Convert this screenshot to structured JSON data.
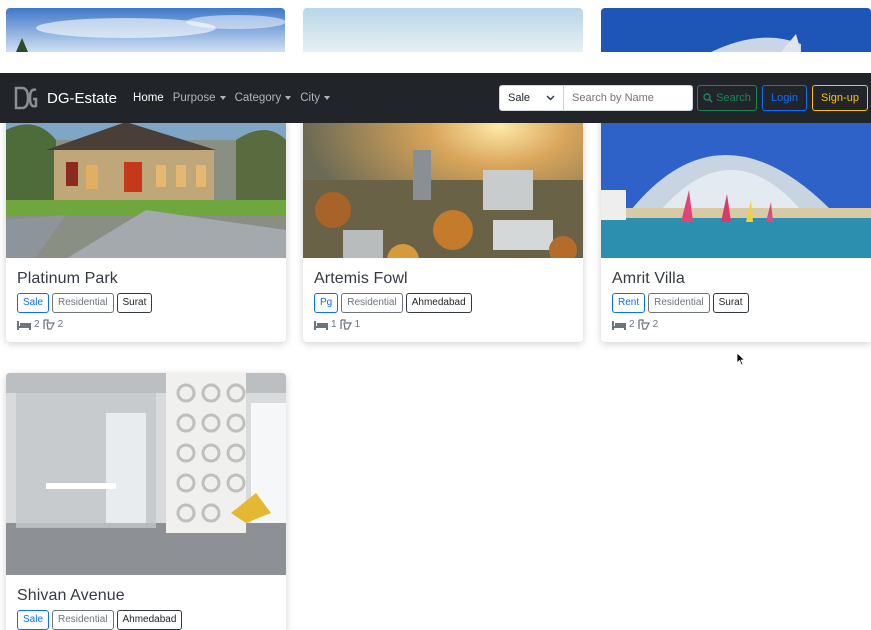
{
  "navbar": {
    "brand": "DG-Estate",
    "links": [
      {
        "label": "Home"
      },
      {
        "label": "Purpose"
      },
      {
        "label": "Category"
      },
      {
        "label": "City"
      }
    ],
    "purpose_select": "Sale",
    "search_placeholder": "Search by Name",
    "search_label": "Search",
    "login_label": "Login",
    "signup_label": "Sign-up",
    "colors": {
      "bg": "#212529",
      "search": "#198754",
      "login": "#0d6efd",
      "signup": "#ffc107"
    }
  },
  "properties": [
    {
      "name": "Platinum Park",
      "purpose": "Sale",
      "category": "Residential",
      "city": "Surat",
      "beds": "2",
      "baths": "2"
    },
    {
      "name": "Artemis Fowl",
      "purpose": "Pg",
      "category": "Residential",
      "city": "Ahmedabad",
      "beds": "1",
      "baths": "1"
    },
    {
      "name": "Amrit Villa",
      "purpose": "Rent",
      "category": "Residential",
      "city": "Surat",
      "beds": "2",
      "baths": "2"
    },
    {
      "name": "Shivan Avenue",
      "purpose": "Sale",
      "category": "Residential",
      "city": "Ahmedabad"
    }
  ]
}
